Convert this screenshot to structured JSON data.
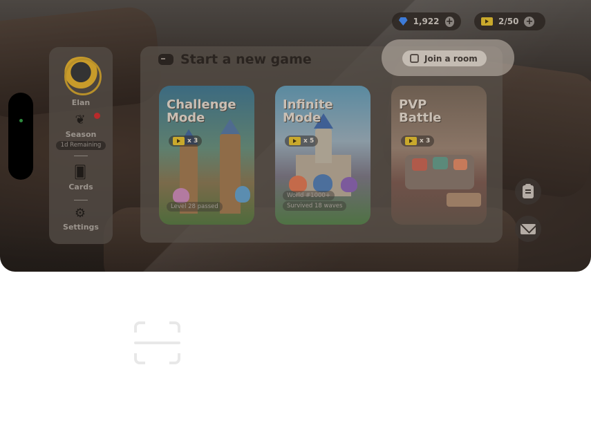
{
  "resources": {
    "gems": {
      "value": "1,922",
      "icon": "gem-icon"
    },
    "tickets": {
      "value": "2/50",
      "icon": "ticket-icon"
    }
  },
  "sidebar": {
    "player_name": "Elan",
    "season_label": "Season",
    "season_remaining": "1d Remaining",
    "cards_label": "Cards",
    "settings_label": "Settings"
  },
  "panel": {
    "title": "Start a new game",
    "join_label": "Join a room"
  },
  "modes": [
    {
      "title_line1": "Challenge",
      "title_line2": "Mode",
      "cost": "x 3",
      "info": [
        "Level 28 passed"
      ]
    },
    {
      "title_line1": "Infinite",
      "title_line2": "Mode",
      "cost": "x 5",
      "info": [
        "World #1000+",
        "Survived 18 waves"
      ]
    },
    {
      "title_line1": "PVP",
      "title_line2": "Battle",
      "cost": "x 3",
      "info": []
    }
  ],
  "colors": {
    "accent_gem": "#3d7bd8",
    "accent_ticket": "#c9a92c",
    "notification": "#b82a2a",
    "status_dot": "#2e8a3e"
  }
}
